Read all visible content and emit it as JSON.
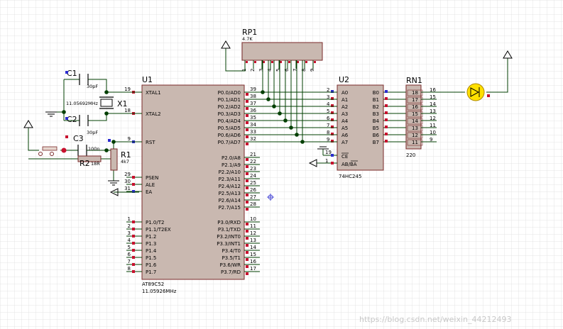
{
  "components": {
    "u1": {
      "ref": "U1",
      "part": "AT89C52",
      "clock": "11.05926MHz",
      "left_pins": [
        {
          "num": "19",
          "name": "XTAL1"
        },
        {
          "num": "18",
          "name": "XTAL2"
        },
        {
          "num": "9",
          "name": "RST"
        },
        {
          "num": "29",
          "name": "PSEN"
        },
        {
          "num": "30",
          "name": "ALE"
        },
        {
          "num": "31",
          "name": "EA"
        },
        {
          "num": "1",
          "name": "P1.0/T2"
        },
        {
          "num": "2",
          "name": "P1.1/T2EX"
        },
        {
          "num": "3",
          "name": "P1.2"
        },
        {
          "num": "4",
          "name": "P1.3"
        },
        {
          "num": "5",
          "name": "P1.4"
        },
        {
          "num": "6",
          "name": "P1.5"
        },
        {
          "num": "7",
          "name": "P1.6"
        },
        {
          "num": "8",
          "name": "P1.7"
        }
      ],
      "right_pins": [
        {
          "num": "39",
          "name": "P0.0/AD0"
        },
        {
          "num": "38",
          "name": "P0.1/AD1"
        },
        {
          "num": "37",
          "name": "P0.2/AD2"
        },
        {
          "num": "36",
          "name": "P0.3/AD3"
        },
        {
          "num": "35",
          "name": "P0.4/AD4"
        },
        {
          "num": "34",
          "name": "P0.5/AD5"
        },
        {
          "num": "33",
          "name": "P0.6/AD6"
        },
        {
          "num": "32",
          "name": "P0.7/AD7"
        },
        {
          "num": "21",
          "name": "P2.0/A8"
        },
        {
          "num": "22",
          "name": "P2.1/A9"
        },
        {
          "num": "23",
          "name": "P2.2/A10"
        },
        {
          "num": "24",
          "name": "P2.3/A11"
        },
        {
          "num": "25",
          "name": "P2.4/A12"
        },
        {
          "num": "26",
          "name": "P2.5/A13"
        },
        {
          "num": "27",
          "name": "P2.6/A14"
        },
        {
          "num": "28",
          "name": "P2.7/A15"
        },
        {
          "num": "10",
          "name": "P3.0/RXD"
        },
        {
          "num": "11",
          "name": "P3.1/TXD"
        },
        {
          "num": "12",
          "name": "P3.2/INT0"
        },
        {
          "num": "13",
          "name": "P3.3/INT1"
        },
        {
          "num": "14",
          "name": "P3.4/T0"
        },
        {
          "num": "15",
          "name": "P3.5/T1"
        },
        {
          "num": "16",
          "name": "P3.6/WR"
        },
        {
          "num": "17",
          "name": "P3.7/RD"
        }
      ]
    },
    "u2": {
      "ref": "U2",
      "part": "74HC245",
      "a_pins": [
        {
          "num": "2",
          "name": "A0"
        },
        {
          "num": "3",
          "name": "A1"
        },
        {
          "num": "4",
          "name": "A2"
        },
        {
          "num": "5",
          "name": "A3"
        },
        {
          "num": "6",
          "name": "A4"
        },
        {
          "num": "7",
          "name": "A5"
        },
        {
          "num": "8",
          "name": "A6"
        },
        {
          "num": "9",
          "name": "A7"
        }
      ],
      "b_pins": [
        "B0",
        "B1",
        "B2",
        "B3",
        "B4",
        "B5",
        "B6",
        "B7"
      ],
      "ce": {
        "num": "19",
        "name": "CE"
      },
      "dir": {
        "num": "1",
        "name": "AB/BA"
      }
    },
    "rp1": {
      "ref": "RP1",
      "value": "4.7K",
      "pins": [
        "1",
        "2",
        "3",
        "4",
        "5",
        "6",
        "7",
        "8",
        "9"
      ]
    },
    "rn1": {
      "ref": "RN1",
      "value": "220",
      "left_pins": [
        "18",
        "17",
        "16",
        "15",
        "14",
        "13",
        "12",
        "11"
      ],
      "right_pins": [
        "16",
        "15",
        "14",
        "13",
        "12",
        "11",
        "10",
        "9"
      ]
    },
    "c1": {
      "ref": "C1",
      "value": "30pF"
    },
    "c2": {
      "ref": "C2",
      "value": "30pF"
    },
    "c3": {
      "ref": "C3",
      "value": "100n"
    },
    "x1": {
      "ref": "X1",
      "value": "11.05692MHz"
    },
    "r1": {
      "ref": "R1",
      "value": "4k7"
    },
    "r2": {
      "ref": "R2",
      "value": "18R"
    }
  },
  "colors": {
    "grid": "#d9d9d9",
    "wire": "#003f00",
    "chip_fill": "#c9b8b0",
    "chip_stroke": "#7a2a2a",
    "pin_red": "#c8102e",
    "pin_blue": "#2b2bd0",
    "led": "#ffe000"
  },
  "watermark": "https://blog.csdn.net/weixin_44212493"
}
